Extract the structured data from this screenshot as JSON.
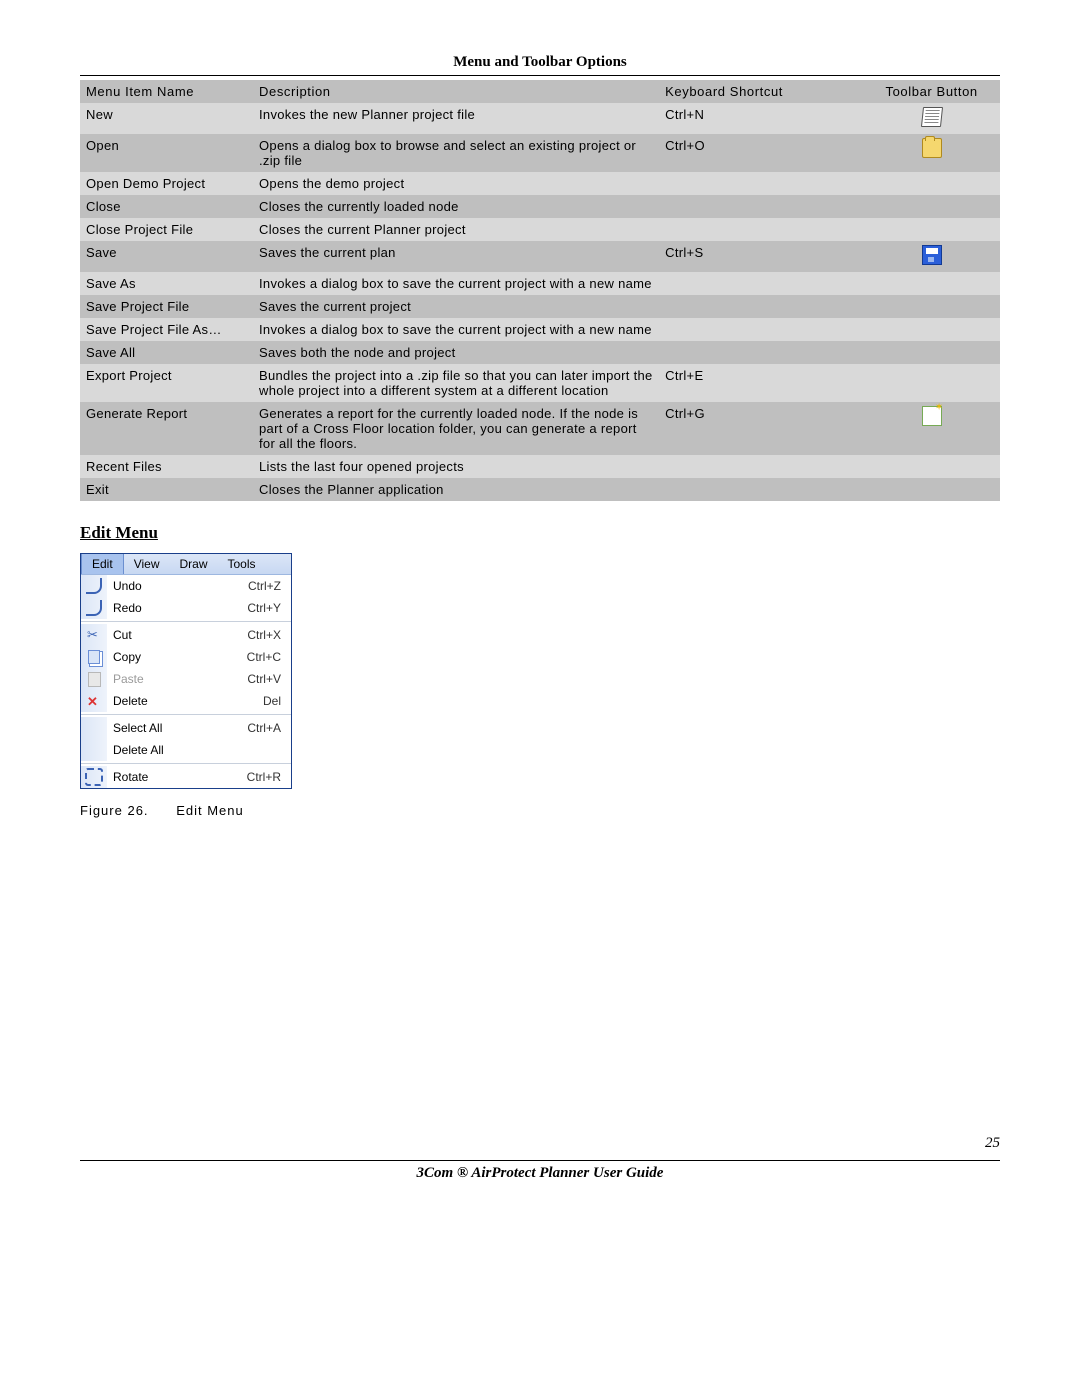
{
  "section_title": "Menu and Toolbar Options",
  "table_headers": {
    "name": "Menu Item Name",
    "desc": "Description",
    "short": "Keyboard Shortcut",
    "btn": "Toolbar Button"
  },
  "rows": [
    {
      "name": "New",
      "desc": "Invokes the new Planner project file",
      "short": "Ctrl+N",
      "icon": "new"
    },
    {
      "name": "Open",
      "desc": "Opens a dialog box to browse and select an existing project or .zip file",
      "short": "Ctrl+O",
      "icon": "open"
    },
    {
      "name": "Open Demo Project",
      "desc": "Opens the demo project",
      "short": "",
      "icon": ""
    },
    {
      "name": "Close",
      "desc": "Closes the currently loaded node",
      "short": "",
      "icon": ""
    },
    {
      "name": "Close Project File",
      "desc": "Closes the current Planner project",
      "short": "",
      "icon": ""
    },
    {
      "name": "Save",
      "desc": "Saves the current plan",
      "short": "Ctrl+S",
      "icon": "save"
    },
    {
      "name": "Save As",
      "desc": "Invokes a dialog box to save the current project with a new name",
      "short": "",
      "icon": ""
    },
    {
      "name": "Save Project File",
      "desc": "Saves the current project",
      "short": "",
      "icon": ""
    },
    {
      "name": "Save Project File As…",
      "desc": "Invokes a dialog box to save the current project with a new name",
      "short": "",
      "icon": ""
    },
    {
      "name": "Save All",
      "desc": "Saves both the node and project",
      "short": "",
      "icon": ""
    },
    {
      "name": "Export Project",
      "desc": "Bundles the project into a .zip file so that you can later import the whole project into a different system at a different location",
      "short": "Ctrl+E",
      "icon": ""
    },
    {
      "name": "Generate Report",
      "desc": "Generates a report for the currently loaded node. If the node is part of a Cross Floor location folder, you can generate a report for all the floors.",
      "short": "Ctrl+G",
      "icon": "report"
    },
    {
      "name": "Recent Files",
      "desc": "Lists the last four opened projects",
      "short": "",
      "icon": ""
    },
    {
      "name": "Exit",
      "desc": "Closes the Planner application",
      "short": "",
      "icon": ""
    }
  ],
  "edit_menu_heading": "Edit Menu",
  "menubar": {
    "tabs": [
      "Edit",
      "View",
      "Draw",
      "Tools"
    ],
    "active": 0
  },
  "edit_items": [
    {
      "icon": "undo",
      "label": "Undo",
      "short": "Ctrl+Z"
    },
    {
      "icon": "redo",
      "label": "Redo",
      "short": "Ctrl+Y"
    },
    {
      "sep": true
    },
    {
      "icon": "cut",
      "label": "Cut",
      "short": "Ctrl+X"
    },
    {
      "icon": "copy",
      "label": "Copy",
      "short": "Ctrl+C"
    },
    {
      "icon": "paste",
      "label": "Paste",
      "short": "Ctrl+V",
      "disabled": true
    },
    {
      "icon": "del",
      "label": "Delete",
      "short": "Del"
    },
    {
      "sep": true
    },
    {
      "icon": "",
      "label": "Select All",
      "short": "Ctrl+A"
    },
    {
      "icon": "",
      "label": "Delete All",
      "short": ""
    },
    {
      "sep": true
    },
    {
      "icon": "rot",
      "label": "Rotate",
      "short": "Ctrl+R"
    }
  ],
  "figure_caption_num": "Figure 26.",
  "figure_caption_text": "Edit Menu",
  "page_number": "25",
  "footer": "3Com ® AirProtect Planner User Guide"
}
